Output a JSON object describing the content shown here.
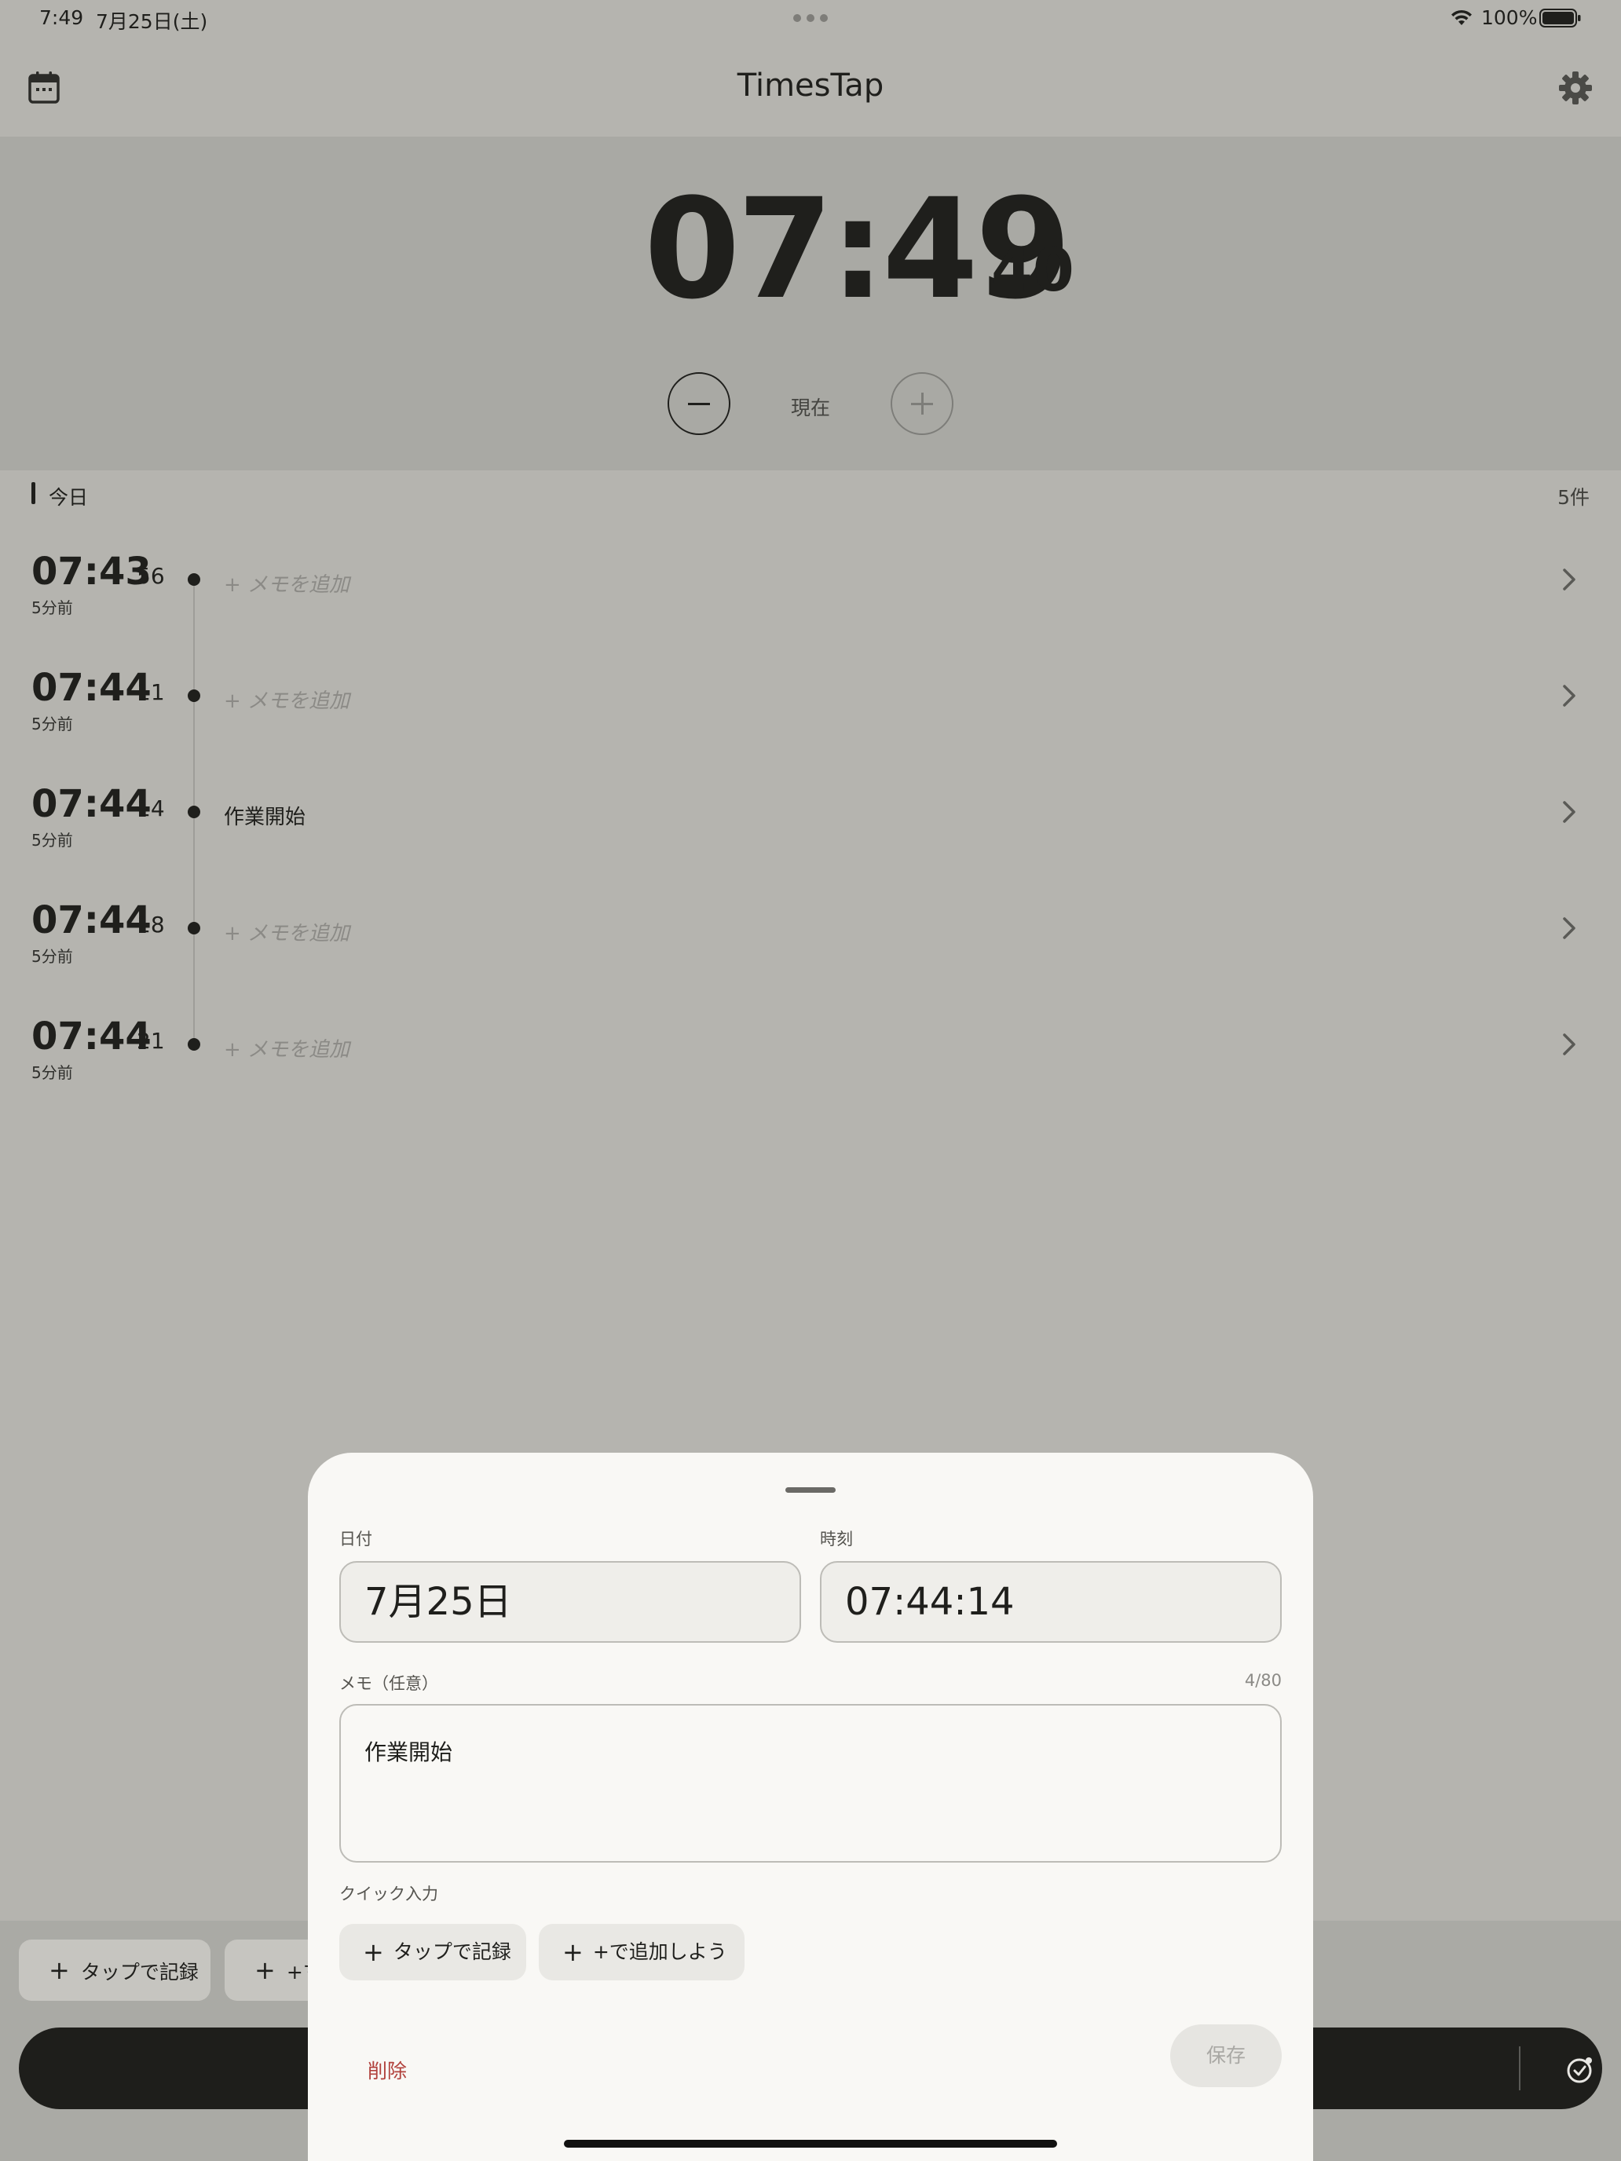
{
  "status_bar": {
    "time": "7:49",
    "date": "7月25日(土)",
    "battery": "100%"
  },
  "header": {
    "title": "TimesTap"
  },
  "clock": {
    "hhmm": "07:49",
    "seconds": "40",
    "now_label": "現在"
  },
  "list": {
    "section_title": "今日",
    "count": "5件",
    "entries": [
      {
        "time": "07:43",
        "sec": "56",
        "ago": "5分前",
        "memo": "+ メモを追加",
        "empty": true
      },
      {
        "time": "07:44",
        "sec": "11",
        "ago": "5分前",
        "memo": "+ メモを追加",
        "empty": true
      },
      {
        "time": "07:44",
        "sec": "14",
        "ago": "5分前",
        "memo": "作業開始",
        "empty": false
      },
      {
        "time": "07:44",
        "sec": "18",
        "ago": "5分前",
        "memo": "+ メモを追加",
        "empty": true
      },
      {
        "time": "07:44",
        "sec": "21",
        "ago": "5分前",
        "memo": "+ メモを追加",
        "empty": true
      }
    ]
  },
  "bottom": {
    "chip1": "タップで記録",
    "chip2": "+マ"
  },
  "sheet": {
    "date_label": "日付",
    "date_value": "7月25日",
    "time_label": "時刻",
    "time_value": "07:44:14",
    "memo_label": "メモ（任意）",
    "memo_count": "4/80",
    "memo_value": "作業開始",
    "quick_label": "クイック入力",
    "quick_chips": [
      "タップで記録",
      "+で追加しよう"
    ],
    "delete_label": "削除",
    "save_label": "保存"
  },
  "colors": {
    "background": "#b5b4af",
    "clock_panel": "#a9a9a4",
    "sheet": "#f9f8f5",
    "delete": "#b1413c",
    "record_bar": "#1e1e1b"
  }
}
